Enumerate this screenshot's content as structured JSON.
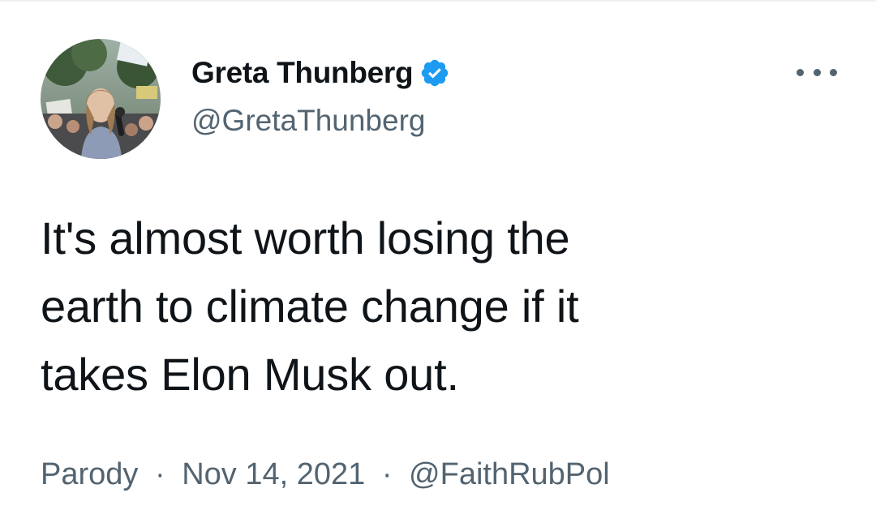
{
  "author": {
    "display_name": "Greta Thunberg",
    "handle": "@GretaThunberg",
    "verified": true,
    "verified_icon": "verified-badge-icon",
    "avatar_icon": "profile-photo"
  },
  "menu": {
    "icon": "more-horizontal-icon"
  },
  "tweet": {
    "lines": [
      "It's almost worth losing the",
      "earth to climate change if it",
      "takes Elon Musk out."
    ]
  },
  "meta": {
    "label": "Parody",
    "separator": "·",
    "date": "Nov 14, 2021",
    "source": "@FaithRubPol"
  },
  "colors": {
    "text_primary": "#0f1419",
    "text_secondary": "#536471",
    "verified_blue": "#1d9bf0",
    "background": "#ffffff"
  }
}
